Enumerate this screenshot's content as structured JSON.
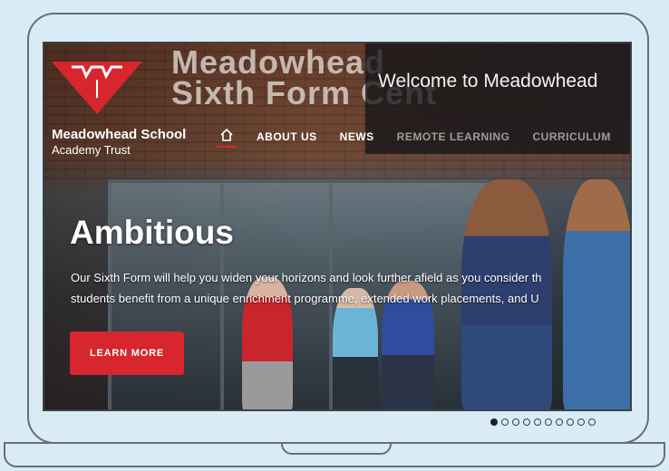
{
  "site": {
    "sign": "Meadowhead School\nSixth Form Centre",
    "brand_name": "Meadowhead School",
    "brand_sub": "Academy Trust",
    "logo_icon": "meadowhead-logo-icon",
    "accent_color": "#d7262d"
  },
  "nav": {
    "home_icon": "home-icon",
    "items": [
      {
        "label": "ABOUT US"
      },
      {
        "label": "NEWS"
      },
      {
        "label": "REMOTE LEARNING"
      },
      {
        "label": "CURRICULUM"
      }
    ]
  },
  "welcome": {
    "text": "Welcome to Meadowhead"
  },
  "hero": {
    "title": "Ambitious",
    "line1": "Our Sixth Form will help you widen your horizons and look further afield as you consider th",
    "line2": "students benefit from a unique enrichment programme, extended work placements, and U",
    "cta_label": "LEARN MORE"
  },
  "carousel": {
    "slide_count": 10,
    "active_index": 0
  }
}
